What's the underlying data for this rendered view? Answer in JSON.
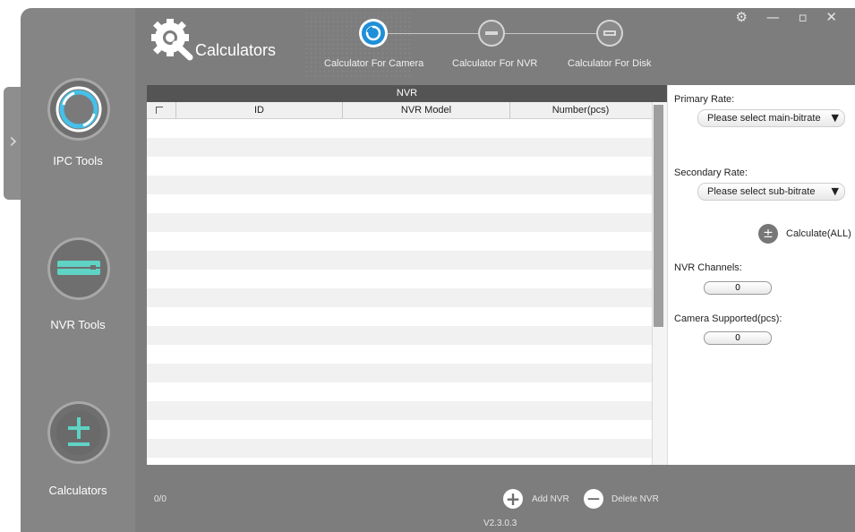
{
  "app": {
    "title": "Calculators",
    "version": "V2.3.0.3"
  },
  "window_controls": "⚙ — ▫ ✕",
  "sidebar": {
    "expand_arrow": "›",
    "items": [
      {
        "label": "IPC Tools",
        "icon": "ipc-camera-icon"
      },
      {
        "label": "NVR Tools",
        "icon": "nvr-device-icon"
      },
      {
        "label": "Calculators",
        "icon": "plus-minus-icon"
      }
    ]
  },
  "steps": [
    {
      "label": "Calculator For Camera",
      "state": "active"
    },
    {
      "label": "Calculator For NVR",
      "state": "inactive"
    },
    {
      "label": "Calculator For Disk",
      "state": "inactive"
    }
  ],
  "table": {
    "title": "NVR",
    "columns": [
      "ID",
      "NVR Model",
      "Number(pcs)"
    ],
    "rows": []
  },
  "right_panel": {
    "primary_rate_label": "Primary Rate:",
    "primary_rate_value": "Please select main-bitrate",
    "secondary_rate_label": "Secondary Rate:",
    "secondary_rate_value": "Please select sub-bitrate",
    "calculate_label": "Calculate(ALL)",
    "calculate_icon": "±",
    "nvr_channels_label": "NVR Channels:",
    "nvr_channels_value": "0",
    "camera_supported_label": "Camera Supported(pcs):",
    "camera_supported_value": "0"
  },
  "footer": {
    "page_count": "0/0",
    "add_label": "Add NVR",
    "add_icon": "+",
    "delete_label": "Delete NVR",
    "delete_icon": "—"
  },
  "colors": {
    "sidebar": "#858585",
    "main": "#7d7d7d",
    "accent": "#1e8fd8",
    "table_header": "#545454"
  }
}
